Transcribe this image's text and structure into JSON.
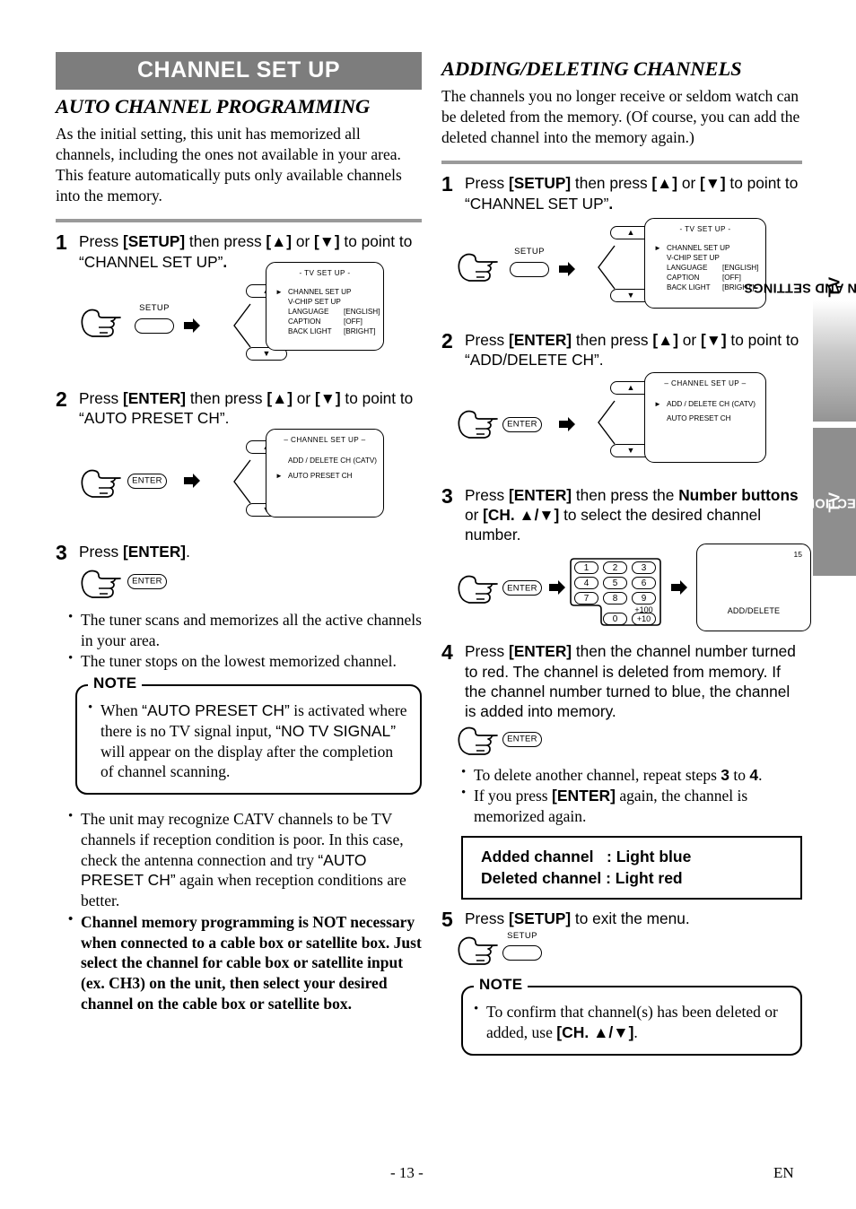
{
  "banner": {
    "title": "CHANNEL SET UP"
  },
  "left": {
    "heading": "AUTO CHANNEL PROGRAMMING",
    "intro": "As the initial setting, this unit has memorized all channels, including the ones not available in your area. This feature automatically puts only available channels into the memory.",
    "steps": [
      {
        "num": "1",
        "text_1": "Press ",
        "bold_1": "[SETUP]",
        "text_2": " then press ",
        "bold_2": "[▲]",
        "text_3": " or ",
        "bold_3": "[▼]",
        "text_4": " to point to “CHANNEL SET UP”",
        "text_5": "."
      },
      {
        "num": "2",
        "text_1": "Press ",
        "bold_1": "[ENTER]",
        "text_2": " then press ",
        "bold_2": "[▲]",
        "text_3": " or ",
        "bold_3": "[▼]",
        "text_4": " to point to “AUTO PRESET CH”.",
        "text_5": ""
      },
      {
        "num": "3",
        "text_1": "Press ",
        "bold_1": "[ENTER]",
        "text_2": ".",
        "bold_2": "",
        "text_3": "",
        "bold_3": "",
        "text_4": "",
        "text_5": ""
      }
    ],
    "diagram1": {
      "button_label": "SETUP",
      "up_label": "▲",
      "down_label": "▼",
      "screen": {
        "title": "- TV SET UP -",
        "rows": [
          {
            "pointer": "►",
            "label": "CHANNEL SET UP",
            "value": ""
          },
          {
            "pointer": "",
            "label": "V-CHIP SET UP",
            "value": ""
          },
          {
            "pointer": "",
            "label": "LANGUAGE",
            "value": "[ENGLISH]"
          },
          {
            "pointer": "",
            "label": "CAPTION",
            "value": "[OFF]"
          },
          {
            "pointer": "",
            "label": "BACK LIGHT",
            "value": "[BRIGHT]"
          }
        ]
      }
    },
    "diagram2": {
      "button_label": "ENTER",
      "up_label": "▲",
      "down_label": "▼",
      "screen": {
        "title": "– CHANNEL SET UP –",
        "rows": [
          {
            "pointer": "",
            "label": "ADD / DELETE CH (CATV)",
            "value": ""
          },
          {
            "pointer": "►",
            "label": "AUTO PRESET CH",
            "value": ""
          }
        ]
      }
    },
    "diagram3": {
      "button_label": "ENTER"
    },
    "bullets_after_step3": [
      "The tuner scans and memorizes all the active channels in your area.",
      "The tuner stops on the lowest memorized channel."
    ],
    "note": {
      "label": "NOTE",
      "text_1": "When ",
      "quoted_1": "“AUTO PRESET CH”",
      "text_2": " is activated where there is no TV signal input, ",
      "quoted_2": "“NO TV SIGNAL”",
      "text_3": " will appear on the display after the completion of channel scanning."
    },
    "bullets_bottom": [
      {
        "bold": false,
        "text_1": "The unit may recognize CATV channels to be TV channels if reception condition is poor. In this case, check the antenna connection and try ",
        "quoted": "“AUTO PRESET CH”",
        "text_2": " again when reception conditions are better."
      },
      {
        "bold": true,
        "text_1": "Channel memory programming is NOT necessary when connected to a cable box or satellite box. Just select the channel for cable box or satellite input (ex. CH3) on the unit, then select your desired channel on the cable box or satellite box.",
        "quoted": "",
        "text_2": ""
      }
    ]
  },
  "right": {
    "heading": "ADDING/DELETING CHANNELS",
    "intro": "The channels you no longer receive or seldom watch can be deleted from the memory. (Of course, you can add the deleted channel into the memory again.)",
    "steps": [
      {
        "num": "1",
        "text_1": "Press ",
        "bold_1": "[SETUP]",
        "text_2": " then press ",
        "bold_2": "[▲]",
        "text_3": " or ",
        "bold_3": "[▼]",
        "text_4": " to point to “CHANNEL SET UP”",
        "text_5": "."
      },
      {
        "num": "2",
        "text_1": "Press ",
        "bold_1": "[ENTER]",
        "text_2": " then press ",
        "bold_2": "[▲]",
        "text_3": " or ",
        "bold_3": "[▼]",
        "text_4": " to point to “ADD/DELETE CH”.",
        "text_5": ""
      },
      {
        "num": "3",
        "text_1": "Press ",
        "bold_1": "[ENTER]",
        "text_2": " then press the ",
        "bold_2": "Number buttons",
        "text_3": " or ",
        "bold_3": "[CH. ▲/▼]",
        "text_4": " to select the desired channel number.",
        "text_5": ""
      },
      {
        "num": "4",
        "text_1": "Press ",
        "bold_1": "[ENTER]",
        "text_2": " then the channel number turned to red. The channel is deleted from memory. If the channel number turned to blue, the channel is added into memory.",
        "bold_2": "",
        "text_3": "",
        "bold_3": "",
        "text_4": "",
        "text_5": ""
      },
      {
        "num": "5",
        "text_1": "Press ",
        "bold_1": "[SETUP]",
        "text_2": " to exit the menu.",
        "bold_2": "",
        "text_3": "",
        "bold_3": "",
        "text_4": "",
        "text_5": ""
      }
    ],
    "diagram1": {
      "button_label": "SETUP",
      "up_label": "▲",
      "down_label": "▼",
      "screen": {
        "title": "- TV SET UP -",
        "rows": [
          {
            "pointer": "►",
            "label": "CHANNEL SET UP",
            "value": ""
          },
          {
            "pointer": "",
            "label": "V-CHIP SET UP",
            "value": ""
          },
          {
            "pointer": "",
            "label": "LANGUAGE",
            "value": "[ENGLISH]"
          },
          {
            "pointer": "",
            "label": "CAPTION",
            "value": "[OFF]"
          },
          {
            "pointer": "",
            "label": "BACK LIGHT",
            "value": "[BRIGHT]"
          }
        ]
      }
    },
    "diagram2": {
      "button_label": "ENTER",
      "up_label": "▲",
      "down_label": "▼",
      "screen": {
        "title": "– CHANNEL SET UP –",
        "rows": [
          {
            "pointer": "►",
            "label": "ADD / DELETE CH (CATV)",
            "value": ""
          },
          {
            "pointer": "",
            "label": "AUTO PRESET CH",
            "value": ""
          }
        ]
      }
    },
    "diagram3": {
      "button_label": "ENTER",
      "keys": [
        "1",
        "2",
        "3",
        "4",
        "5",
        "6",
        "7",
        "8",
        "9",
        "0",
        "+10"
      ],
      "key_sup": "+100",
      "screen": {
        "corner": "15",
        "center": "ADD/DELETE"
      }
    },
    "diagram4": {
      "button_label": "ENTER"
    },
    "diagram5": {
      "button_label": "SETUP"
    },
    "bullets_after_step4": [
      {
        "text_1": "To delete another channel, repeat steps ",
        "bold_1": "3",
        "text_2": " to ",
        "bold_2": "4",
        "text_3": "."
      },
      {
        "text_1": "If you press ",
        "bold_1": "[ENTER]",
        "text_2": " again, the channel is memorized again.",
        "bold_2": "",
        "text_3": ""
      }
    ],
    "callout": "Added channel   : Light blue\nDeleted channel : Light red",
    "note": {
      "label": "NOTE",
      "text_1": "To confirm that channel(s) has been deleted or added, use ",
      "bold_1": "[CH. ▲/▼]",
      "text_2": "."
    }
  },
  "tabs": {
    "settings_prefix": "TV",
    "settings_label": "OPERATION AND SETTINGS",
    "section_prefix": "TV",
    "section_label": "SECTION"
  },
  "footer": {
    "page": "- 13 -",
    "language": "EN"
  }
}
